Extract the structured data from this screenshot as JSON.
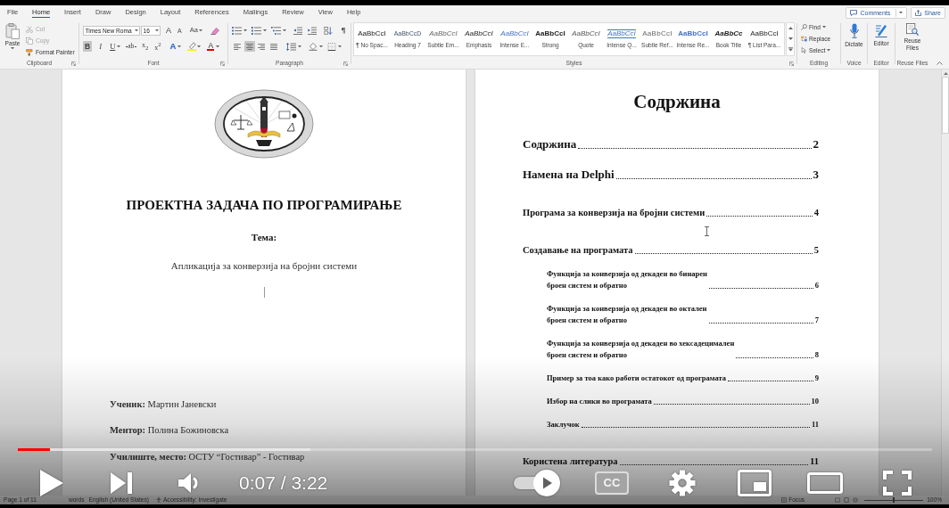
{
  "ribbon_tabs": [
    {
      "label": "File",
      "selected": false
    },
    {
      "label": "Home",
      "selected": true
    },
    {
      "label": "Insert",
      "selected": false
    },
    {
      "label": "Draw",
      "selected": false
    },
    {
      "label": "Design",
      "selected": false
    },
    {
      "label": "Layout",
      "selected": false
    },
    {
      "label": "References",
      "selected": false
    },
    {
      "label": "Mailings",
      "selected": false
    },
    {
      "label": "Review",
      "selected": false
    },
    {
      "label": "View",
      "selected": false
    },
    {
      "label": "Help",
      "selected": false
    }
  ],
  "header_buttons": {
    "comments": "Comments",
    "share": "Share"
  },
  "clipboard": {
    "paste": "Paste",
    "items": [
      {
        "kind": "cut",
        "label": "Cut",
        "disabled": true
      },
      {
        "kind": "copy",
        "label": "Copy",
        "disabled": true
      },
      {
        "kind": "painter",
        "label": "Format Painter",
        "disabled": false
      }
    ],
    "group_label": "Clipboard"
  },
  "font": {
    "name": "Times New Roma",
    "size": "16",
    "tools": [
      {
        "kind": "grow",
        "label": "A"
      },
      {
        "kind": "shrink",
        "label": "A"
      },
      {
        "kind": "case",
        "label": "Aa"
      }
    ],
    "formats": [
      {
        "kind": "bold",
        "label": "B",
        "selected": true
      },
      {
        "kind": "italic",
        "label": "I",
        "selected": false
      },
      {
        "kind": "underline",
        "label": "U",
        "selected": false
      },
      {
        "kind": "strike",
        "label": "ab",
        "selected": false
      },
      {
        "kind": "subscript",
        "label": "x$_{2}$",
        "selected": false
      },
      {
        "kind": "superscript",
        "label": "x$^{2}$",
        "selected": false
      }
    ],
    "colors": [
      {
        "kind": "effects",
        "label": "A"
      },
      {
        "kind": "highlight"
      },
      {
        "kind": "fontcolor",
        "label": "A"
      }
    ],
    "group_label": "Font"
  },
  "paragraph": {
    "alignments": [
      {
        "kind": "left",
        "selected": false
      },
      {
        "kind": "center",
        "selected": true
      },
      {
        "kind": "right",
        "selected": false
      },
      {
        "kind": "justify",
        "selected": false
      }
    ],
    "show_marks": {
      "label": "¶",
      "on": false
    },
    "group_label": "Paragraph"
  },
  "styles": {
    "items": [
      {
        "kind": "normal",
        "preview": "AaBbCcI",
        "name": "¶ No Spac...",
        "selected": false
      },
      {
        "kind": "heading",
        "preview": "AaBbCcD",
        "name": "Heading 7",
        "selected": false
      },
      {
        "kind": "subtle",
        "preview": "AaBbCcI",
        "name": "Subtle Em...",
        "selected": false
      },
      {
        "kind": "emphasis",
        "preview": "AaBbCcI",
        "name": "Emphasis",
        "selected": false
      },
      {
        "kind": "intense",
        "preview": "AaBbCcI",
        "name": "Intense E...",
        "selected": false
      },
      {
        "kind": "strong",
        "preview": "AaBbCcI",
        "name": "Strong",
        "selected": false
      },
      {
        "kind": "quote",
        "preview": "AaBbCcI",
        "name": "Quote",
        "selected": false
      },
      {
        "kind": "intensequote",
        "preview": "AaBbCcI",
        "name": "Intense Q...",
        "selected": false
      },
      {
        "kind": "subtleref",
        "preview": "AaBbCcI",
        "name": "Subtle Ref...",
        "selected": false
      },
      {
        "kind": "intenseref",
        "preview": "AaBbCcI",
        "name": "Intense Re...",
        "selected": false
      },
      {
        "kind": "booktitle",
        "preview": "AaBbCc",
        "name": "Book Title",
        "selected": false
      },
      {
        "kind": "normal",
        "preview": "AaBbCcI",
        "name": "¶ List Para...",
        "selected": false
      }
    ],
    "group_label": "Styles"
  },
  "editing": {
    "items": [
      {
        "kind": "find",
        "label": "Find"
      },
      {
        "kind": "replace",
        "label": "Replace"
      },
      {
        "kind": "select",
        "label": "Select"
      }
    ],
    "group_label": "Editing"
  },
  "voice": {
    "button": "Dictate",
    "group_label": "Voice"
  },
  "editor": {
    "button": "Editor",
    "group_label": "Editor"
  },
  "reuse_files": {
    "button": "Reuse Files",
    "group_label": "Reuse Files"
  },
  "cover_page": {
    "title": "ПРОЕКТНА ЗАДАЧА ПО ПРОГРАМИРАЊЕ",
    "topic_label": "Тема:",
    "topic": "Апликација за конверзија на бројни системи",
    "details": [
      "**Ученик:** Мартин Јаневски",
      "**Ментор:** Полина Божиновска",
      "**Училиште, место:** ОСТУ “Гостивар” - Гостивар"
    ]
  },
  "toc_page": {
    "heading": "Содржина",
    "entries": [
      {
        "kind": "large",
        "title": "Содржина",
        "page": "2"
      },
      {
        "kind": "large",
        "title": "Намена на Delphi",
        "page": "3"
      },
      {
        "kind": "medium",
        "title": "Програма за конверзија на бројни системи",
        "page": "4"
      },
      {
        "kind": "medium",
        "title": "Создавање на програмата",
        "page": "5",
        "children": [
          {
            "title": "Функција за конверзија од декаден во бинарен\nброен систем и обратно",
            "page": "6"
          },
          {
            "title": "Функција за конверзија од декаден во октален\nброен систем и обратно",
            "page": "7"
          },
          {
            "title": "Функција за конверзија од декаден во хексадецимален\nброен систем и обратно",
            "page": "8"
          },
          {
            "title": "Пример за тоа како работи остатокот од програмата",
            "page": "9"
          },
          {
            "title": "Избор на слики во програмата",
            "page": "10"
          },
          {
            "title": "Заклучок",
            "page": "11"
          }
        ]
      },
      {
        "kind": "medium",
        "title": "Користена литература",
        "page": "11"
      }
    ]
  },
  "status_bar": {
    "page": "Page 1 of 11",
    "words": "words",
    "language": "English (United States)",
    "accessibility": "Accessibility: Investigate",
    "focus": "Focus",
    "zoom_slider": {
      "level": 0.5
    },
    "zoom": "100%"
  },
  "player": {
    "playing": false,
    "progress": {
      "level": 0.035
    },
    "time": "0:07 / 3:22",
    "autoplay": {
      "on": true
    },
    "captions": {
      "label": "CC",
      "on": false
    }
  }
}
